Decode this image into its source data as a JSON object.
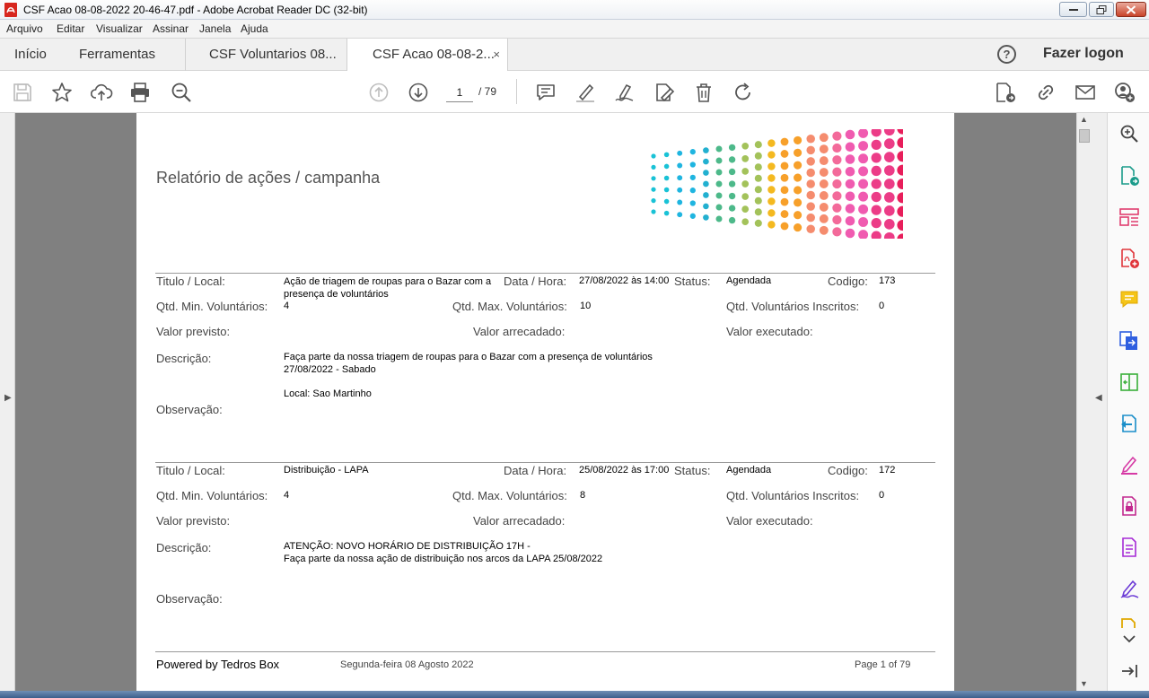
{
  "window": {
    "title": "CSF Acao 08-08-2022 20-46-47.pdf - Adobe Acrobat Reader DC (32-bit)"
  },
  "menu": [
    "Arquivo",
    "Editar",
    "Visualizar",
    "Assinar",
    "Janela",
    "Ajuda"
  ],
  "tabs": {
    "home": "Início",
    "tools": "Ferramentas",
    "doc1": "CSF Voluntarios 08...",
    "doc2": "CSF Acao 08-08-2...",
    "close": "×",
    "login": "Fazer logon"
  },
  "toolbar": {
    "page_current": "1",
    "page_total": "/ 79"
  },
  "report": {
    "title": "Relatório de ações / campanha",
    "labels": {
      "titulo": "Titulo / Local:",
      "data": "Data / Hora:",
      "status": "Status:",
      "codigo": "Codigo:",
      "min": "Qtd. Min. Voluntários:",
      "max": "Qtd. Max. Voluntários:",
      "inscritos": "Qtd. Voluntários Inscritos:",
      "previsto": "Valor previsto:",
      "arrecadado": "Valor arrecadado:",
      "executado": "Valor executado:",
      "descricao": "Descrição:",
      "observacao": "Observação:"
    },
    "records": [
      {
        "titulo_line1": "Ação de triagem de roupas para o Bazar com a",
        "titulo_line2": "presença de voluntários",
        "data": "27/08/2022 às 14:00",
        "status": "Agendada",
        "codigo": "173",
        "min": "4",
        "max": "10",
        "inscritos": "0",
        "descricao_line1": "Faça parte da nossa triagem de roupas para o Bazar com a presença de voluntários",
        "descricao_line2": "27/08/2022 - Sabado",
        "descricao_line3": "Local: Sao Martinho"
      },
      {
        "titulo_line1": "Distribuição - LAPA",
        "data": "25/08/2022 às 17:00",
        "status": "Agendada",
        "codigo": "172",
        "min": "4",
        "max": "8",
        "inscritos": "0",
        "descricao_line1": "ATENÇÃO: NOVO HORÁRIO DE DISTRIBUIÇÃO 17H -",
        "descricao_line2": "Faça parte da nossa ação de distribuição nos arcos da LAPA 25/08/2022"
      }
    ],
    "footer": {
      "brand": "Powered by Tedros Box",
      "date": "Segunda-feira 08 Agosto 2022",
      "page": "Page 1 of 79"
    }
  },
  "colors": {
    "accent_red": "#d7261e",
    "logo_palette": [
      "#19c2d6",
      "#1fb5e0",
      "#22b0d0",
      "#4db98a",
      "#a3c25a",
      "#f4b920",
      "#f7a02a",
      "#f58c6e",
      "#f36a9a",
      "#f05bb0",
      "#ec3c87",
      "#e81e5b"
    ]
  },
  "icons": {
    "toolbar": [
      "save-icon",
      "bookmark-star-icon",
      "upload-cloud-icon",
      "print-icon",
      "zoom-out-icon",
      "prev-page-icon",
      "next-page-icon",
      "comment-icon",
      "highlight-pen-icon",
      "sign-icon",
      "edit-doc-icon",
      "delete-icon",
      "rotate-icon",
      "export-pdf-icon",
      "share-link-icon",
      "email-icon",
      "add-user-icon"
    ],
    "tools_pane": [
      "zoom-search-icon",
      "export-pdf-icon",
      "organize-pages-icon",
      "create-pdf-icon",
      "comment-icon",
      "combine-files-icon",
      "compress-icon",
      "send-for-review-icon",
      "fill-sign-icon",
      "protect-icon",
      "edit-pdf-icon",
      "certificate-icon",
      "more-tools-icon",
      "collapse-pane-icon"
    ]
  }
}
